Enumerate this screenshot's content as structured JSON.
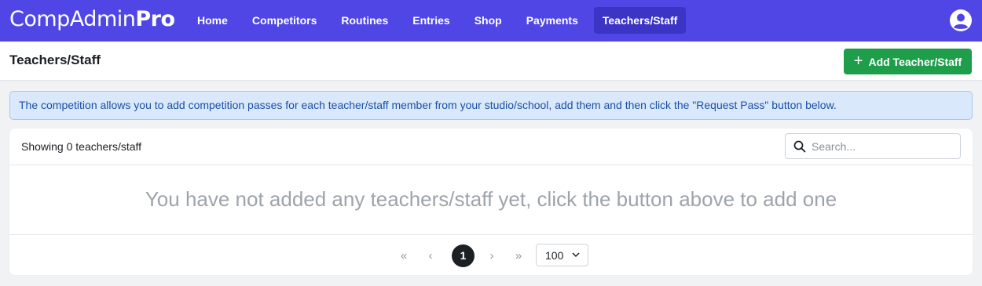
{
  "app": {
    "brand_light": "CompAdmin",
    "brand_bold": "Pro"
  },
  "nav": {
    "items": [
      {
        "label": "Home"
      },
      {
        "label": "Competitors"
      },
      {
        "label": "Routines"
      },
      {
        "label": "Entries"
      },
      {
        "label": "Shop"
      },
      {
        "label": "Payments"
      },
      {
        "label": "Teachers/Staff",
        "active": true
      }
    ],
    "user_icon": "user-circle-icon"
  },
  "header": {
    "title": "Teachers/Staff",
    "add_button_label": "Add Teacher/Staff",
    "add_button_icon": "plus-icon"
  },
  "alert": {
    "text": "The competition allows you to add competition passes for each teacher/staff member from your studio/school, add them and then click the \"Request Pass\" button below."
  },
  "list": {
    "count_text": "Showing 0 teachers/staff",
    "search_placeholder": "Search...",
    "search_icon": "search-icon",
    "empty_message": "You have not added any teachers/staff yet, click the button above to add one"
  },
  "pagination": {
    "first": "«",
    "prev": "‹",
    "current_page": "1",
    "next": "›",
    "last": "»",
    "per_page": "100"
  },
  "colors": {
    "navbar": "#4f46e5",
    "nav_active": "#3b34c4",
    "add_button": "#1e9e4a",
    "alert_bg": "#d9e8fb",
    "alert_text": "#1d4fa8"
  }
}
